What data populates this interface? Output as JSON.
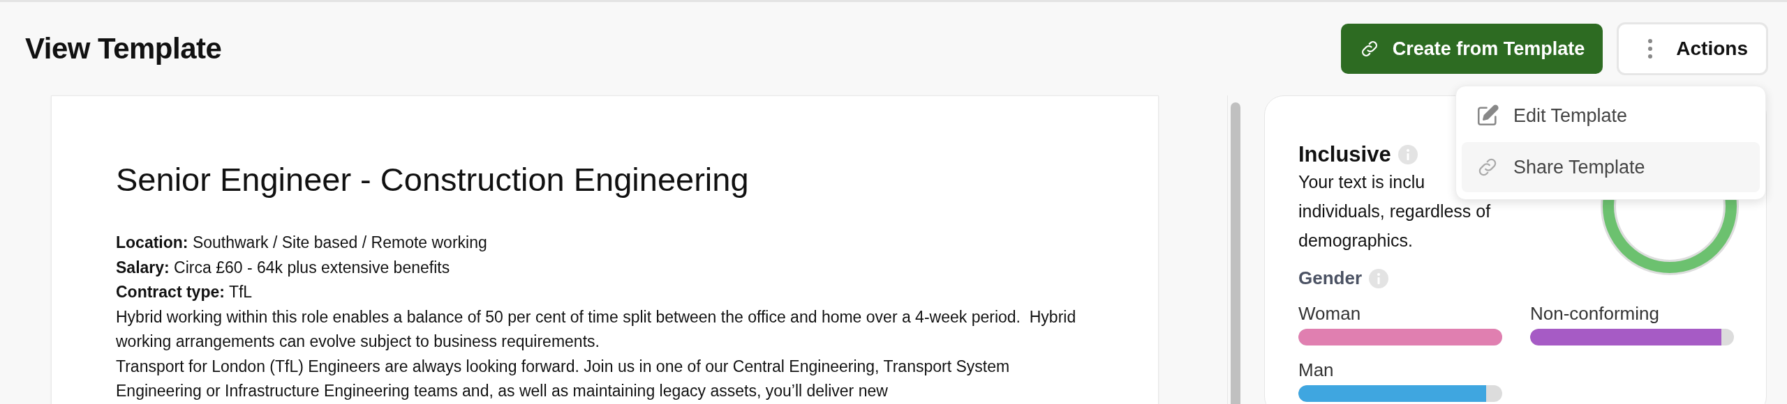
{
  "page": {
    "title": "View Template"
  },
  "toolbar": {
    "create_button": "Create from Template",
    "actions_button": "Actions"
  },
  "actions_menu": {
    "items": [
      {
        "label": "Edit Template",
        "kind": "edit",
        "selected": false
      },
      {
        "label": "Share Template",
        "kind": "share",
        "selected": true
      }
    ]
  },
  "document": {
    "heading": "Senior Engineer - Construction Engineering",
    "paragraphs": [
      "**Location:** Southwark / Site based / Remote working",
      "**Salary:** Circa £60 - 64k plus extensive benefits",
      "**Contract type:** TfL",
      "Hybrid working within this role enables a balance of 50 per cent of time split between the office and home over a 4-week period.  Hybrid working arrangements can evolve subject to business requirements.",
      "Transport for London (TfL) Engineers are always looking forward. Join us in one of our Central Engineering, Transport System Engineering or Infrastructure Engineering teams and, as well as maintaining legacy assets, you’ll deliver new"
    ]
  },
  "inclusivity": {
    "title": "Inclusive",
    "summary_lines": [
      "Your text is inclu",
      "individuals, regardless of",
      "demographics."
    ],
    "gender": {
      "title": "Gender",
      "bars": [
        {
          "label": "Woman",
          "level": 1.0,
          "color": "#e07fb0"
        },
        {
          "label": "Non-conforming",
          "level": 0.94,
          "color": "#a65bc5"
        },
        {
          "label": "Man",
          "level": 0.92,
          "color": "#3fa6e0"
        }
      ]
    }
  }
}
